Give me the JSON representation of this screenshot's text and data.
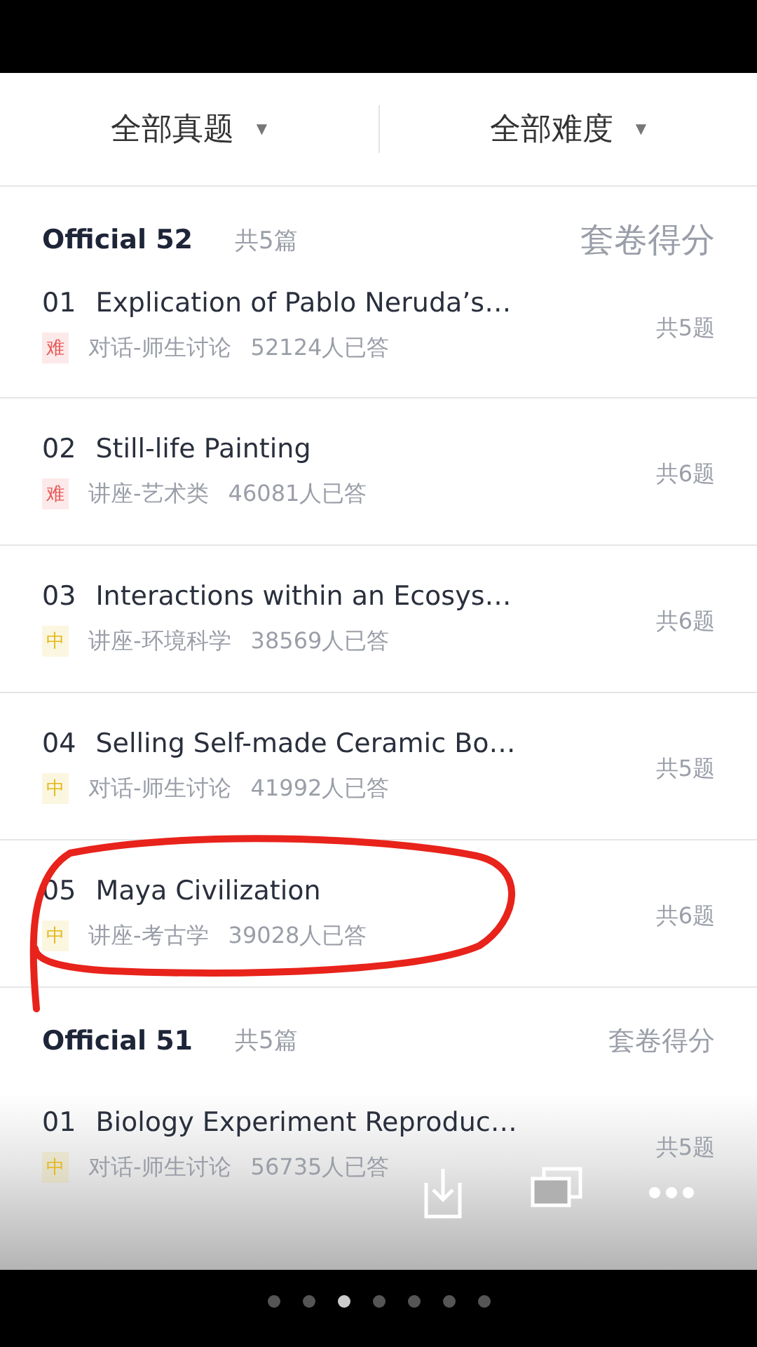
{
  "filters": [
    {
      "label": "全部真题",
      "caret": "▼"
    },
    {
      "label": "全部难度",
      "caret": "▼"
    }
  ],
  "sections": [
    {
      "title": "Official 52",
      "count": "共5篇",
      "score_link": "套卷得分",
      "items": [
        {
          "number": "01",
          "title": "Explication of Pablo Neruda’s…",
          "color": "#e85a5a",
          "tag": "难",
          "category": "对话-师生讨论",
          "answered": "52124人已答",
          "questions": "共5题",
          "circled": false
        },
        {
          "number": "02",
          "title": "Still-life Painting",
          "color": "#e85a5a",
          "tag": "难",
          "category": "讲座-艺术类",
          "answered": "46081人已答",
          "questions": "共6题",
          "circled": false
        },
        {
          "number": "03",
          "title": "Interactions within an Ecosys…",
          "color": "#e3b81a",
          "tag": "中",
          "category": "讲座-环境科学",
          "answered": "38569人已答",
          "questions": "共6题",
          "circled": false
        },
        {
          "number": "04",
          "title": "Selling Self-made Ceramic Bo…",
          "color": "#e3b81a",
          "tag": "中",
          "category": "对话-师生讨论",
          "answered": "41992人已答",
          "questions": "共5题",
          "circled": false
        },
        {
          "number": "05",
          "title": "Maya Civilization",
          "color": "#e3b81a",
          "tag": "中",
          "category": "讲座-考古学",
          "answered": "39028人已答",
          "questions": "共6题",
          "circled": true
        }
      ]
    },
    {
      "title": "Official 51",
      "count": "共5篇",
      "score_link": "套卷得分",
      "items": [
        {
          "number": "01",
          "title": "Biology Experiment Reproduc…",
          "color": "#e3b81a",
          "tag": "中",
          "category": "对话-师生讨论",
          "answered": "56735人已答",
          "questions": "共5题",
          "circled": false
        }
      ]
    }
  ],
  "pager": [
    {
      "selected": false
    },
    {
      "selected": false
    },
    {
      "selected": true
    },
    {
      "selected": false
    },
    {
      "selected": false
    },
    {
      "selected": false
    },
    {
      "selected": false
    }
  ]
}
